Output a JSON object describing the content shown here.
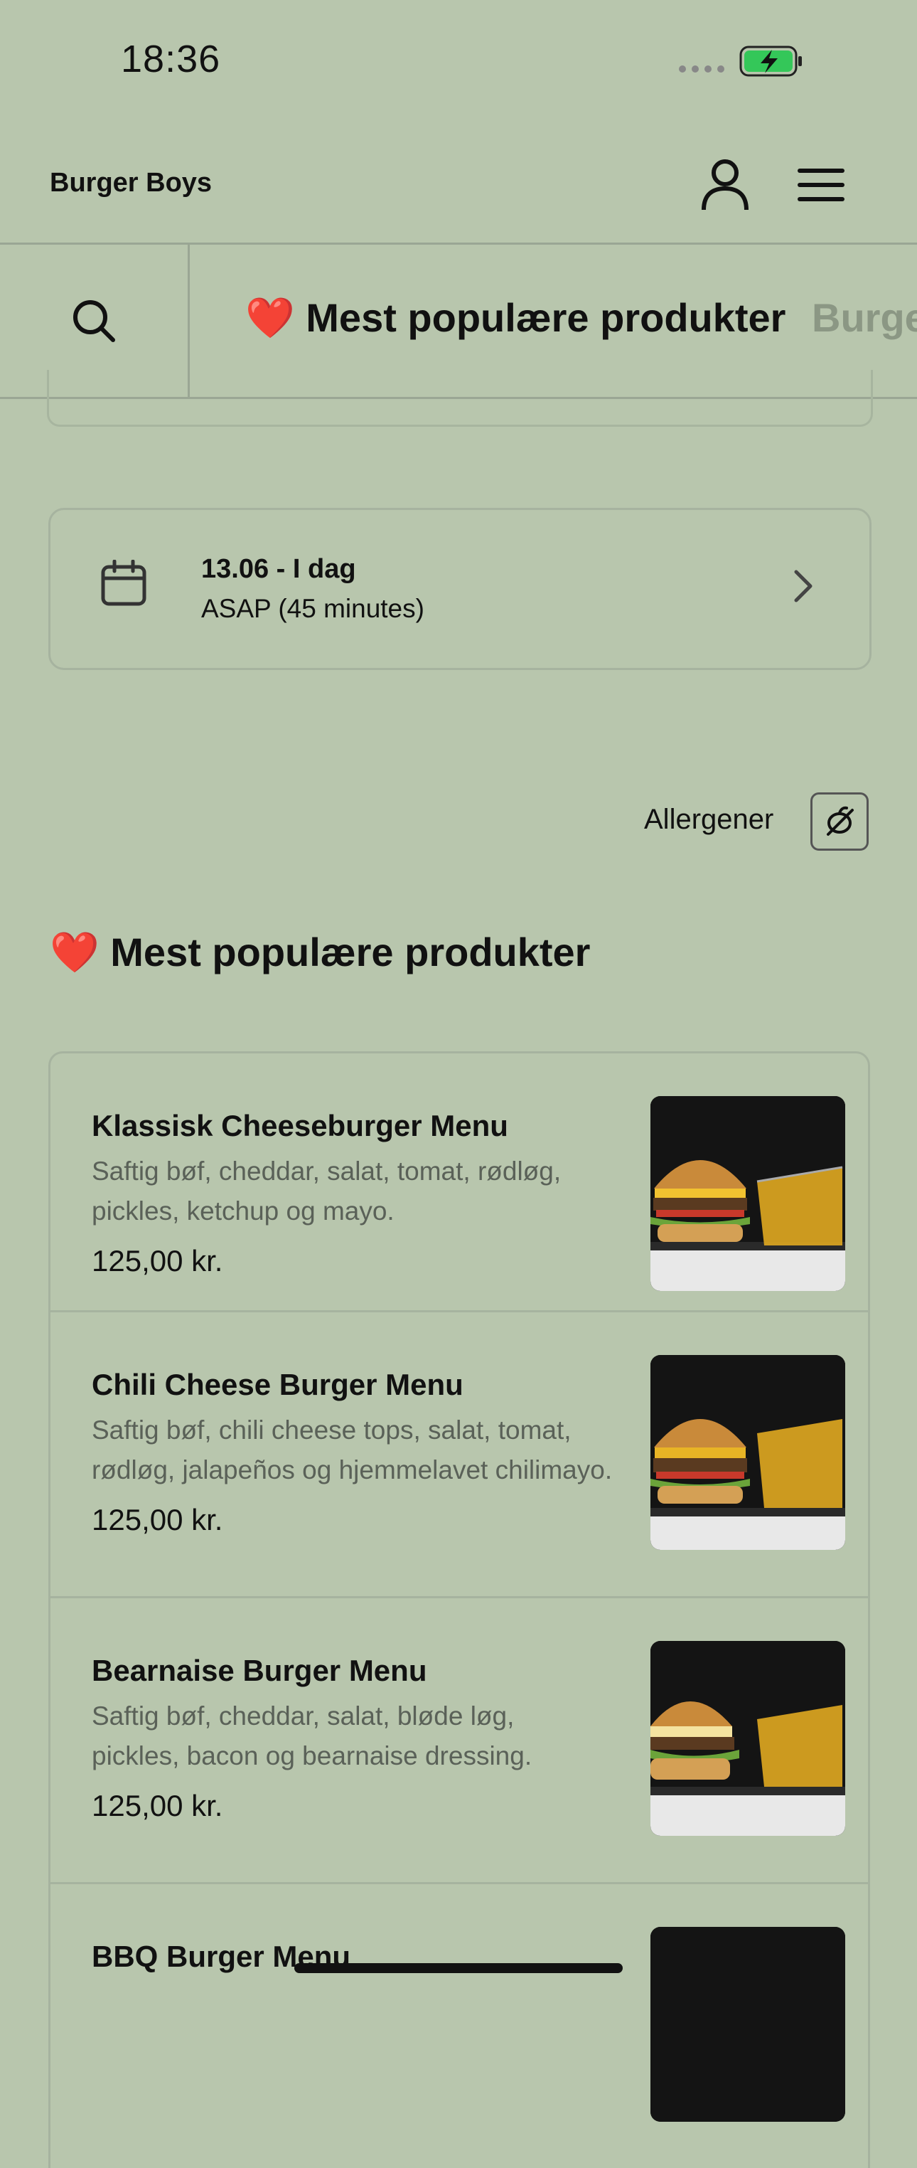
{
  "status_bar": {
    "time": "18:36"
  },
  "header": {
    "title": "Burger Boys"
  },
  "icons": {
    "profile": "person-icon",
    "menu": "hamburger-menu-icon",
    "search": "search-icon",
    "calendar": "calendar-icon",
    "chevron": "chevron-right-icon",
    "allergen": "allergen-icon",
    "heart": "heart-emoji"
  },
  "categories": {
    "active": "❤️ Mest populære produkter",
    "next": "Burgers"
  },
  "delivery": {
    "date": "13.06 - I dag",
    "time": "ASAP (45 minutes)"
  },
  "allergens": {
    "label": "Allergener"
  },
  "section": {
    "title": "❤️ Mest populære produkter"
  },
  "products": [
    {
      "name": "Klassisk Cheeseburger Menu",
      "desc_line1": "Saftig bøf, cheddar, salat, tomat, rødløg,",
      "desc_line2": "pickles, ketchup og mayo.",
      "price": "125,00 kr."
    },
    {
      "name": "Chili Cheese Burger Menu",
      "desc_line1": "Saftig bøf, chili cheese tops, salat, tomat,",
      "desc_line2": "rødløg, jalapeños og hjemmelavet chilimayo.",
      "price": "125,00 kr."
    },
    {
      "name": "Bearnaise Burger Menu",
      "desc_line1": "Saftig bøf, cheddar, salat, bløde løg,",
      "desc_line2": "pickles, bacon og bearnaise dressing.",
      "price": "125,00 kr."
    },
    {
      "name": "BBQ Burger Menu",
      "desc_line1": "",
      "desc_line2": "",
      "price": ""
    }
  ],
  "colors": {
    "background": "#b8c6ad",
    "border": "#a6b39f",
    "battery": "#34c759"
  }
}
